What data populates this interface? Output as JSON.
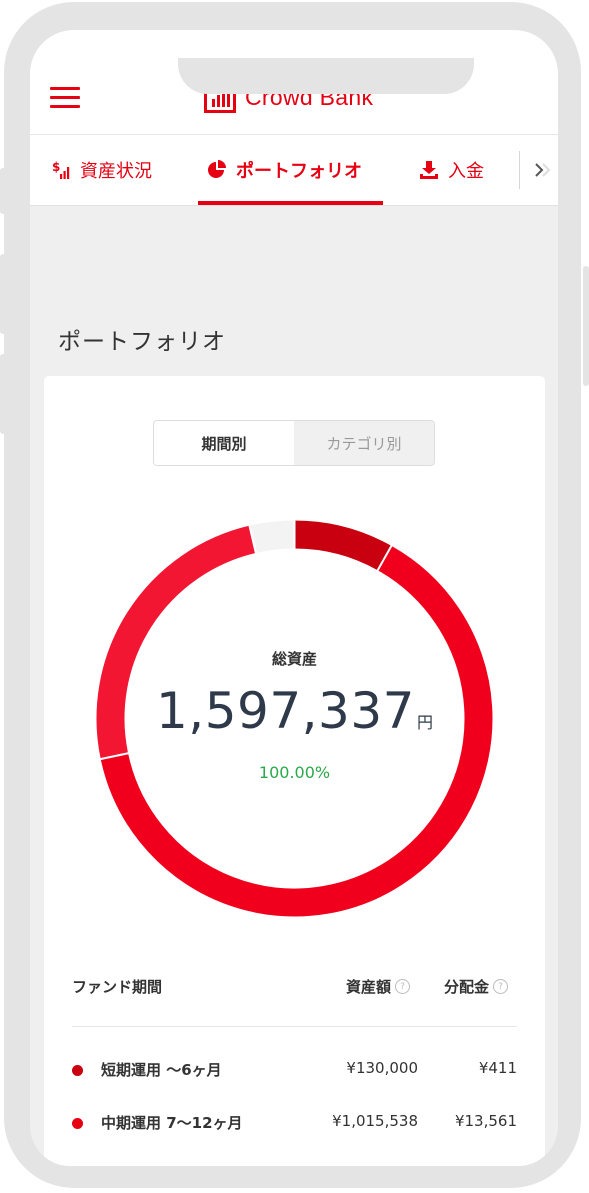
{
  "header": {
    "logo_text": "Crowd Bank",
    "brand_color": "#e60012"
  },
  "tabs": [
    {
      "label": "資産状況",
      "icon": "dollar-chart-icon"
    },
    {
      "label": "ポートフォリオ",
      "icon": "pie-chart-icon",
      "active": true
    },
    {
      "label": "入金",
      "icon": "download-icon"
    }
  ],
  "page": {
    "title": "ポートフォリオ"
  },
  "toggle": {
    "period": "期間別",
    "category": "カテゴリ別",
    "selected": "期間別"
  },
  "summary": {
    "label": "総資産",
    "value": "1,597,337",
    "unit": "円",
    "percent": "100.00%"
  },
  "table": {
    "headers": {
      "fund_period": "ファンド期間",
      "asset_amount": "資産額",
      "distribution": "分配金"
    },
    "rows": [
      {
        "name": "短期運用 〜6ヶ月",
        "amount": "¥130,000",
        "distribution": "¥411",
        "color": "#c8000f"
      },
      {
        "name": "中期運用 7〜12ヶ月",
        "amount": "¥1,015,538",
        "distribution": "¥13,561",
        "color": "#e60012"
      }
    ]
  },
  "chart_data": {
    "type": "pie",
    "series": [
      {
        "value": 0.0814,
        "color": "#c8000f"
      },
      {
        "value": 0.6358,
        "color": "#f0001c"
      },
      {
        "value": 0.2463,
        "color": "#f21632"
      },
      {
        "value": 0.0365,
        "color": "#f3f3f3"
      }
    ]
  }
}
